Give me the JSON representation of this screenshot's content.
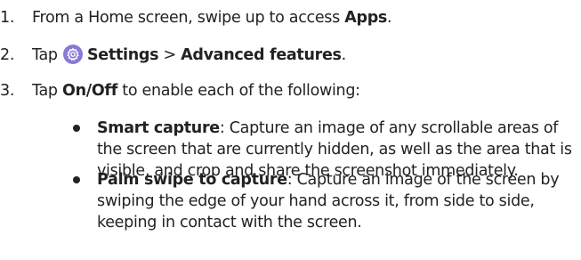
{
  "steps": [
    {
      "num": "1.",
      "pre": "From a Home screen, swipe up to access ",
      "bold": "Apps",
      "post": "."
    },
    {
      "num": "2.",
      "pre": "Tap ",
      "settings": "Settings",
      "sep": " > ",
      "advanced": "Advanced features",
      "post": "."
    },
    {
      "num": "3.",
      "pre": "Tap ",
      "bold": "On/Off",
      "post": " to enable each of the following:"
    }
  ],
  "bullets": [
    {
      "title": "Smart capture",
      "line1": ": Capture an image of any scrollable areas of",
      "line2": "the screen that are currently hidden, as well as the area that is",
      "line3": "visible, and crop and share the screenshot immediately."
    },
    {
      "title": "Palm swipe to capture",
      "line1": ": Capture an image of the screen by",
      "line2": "swiping the edge of your hand across it, from side to side,",
      "line3": "keeping in contact with the screen."
    }
  ],
  "icons": {
    "settings": "settings-gear-icon"
  },
  "colors": {
    "settings_icon": "#8a78d8",
    "text": "#222222"
  }
}
